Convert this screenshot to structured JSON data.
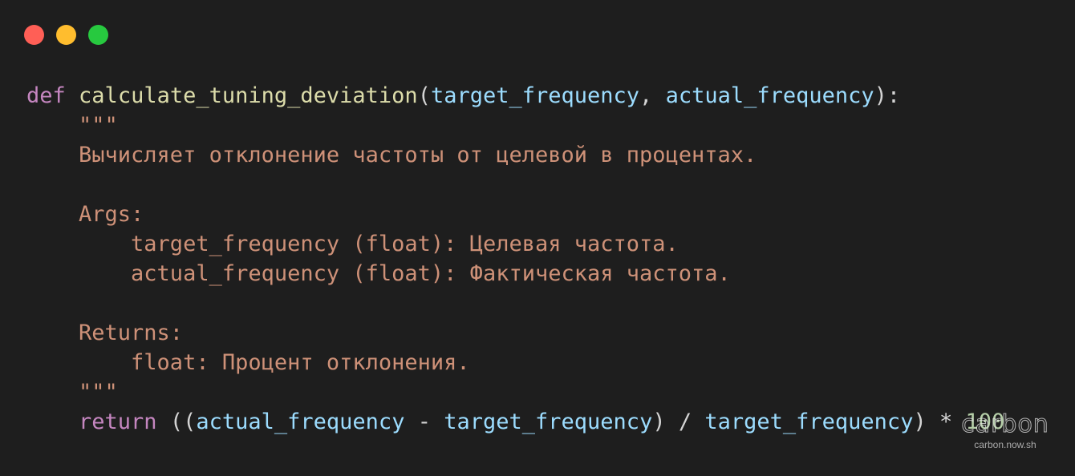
{
  "window": {
    "background": "#1e1e1e",
    "controls": [
      "close",
      "minimize",
      "zoom"
    ],
    "control_colors": {
      "close": "#ff5f56",
      "minimize": "#ffbd2e",
      "zoom": "#27c93f"
    }
  },
  "code": {
    "language": "python",
    "lines": [
      [
        [
          "kw",
          "def"
        ],
        [
          "punc",
          " "
        ],
        [
          "fn",
          "calculate_tuning_deviation"
        ],
        [
          "punc",
          "("
        ],
        [
          "param",
          "target_frequency"
        ],
        [
          "punc",
          ", "
        ],
        [
          "param",
          "actual_frequency"
        ],
        [
          "punc",
          "):"
        ]
      ],
      [
        [
          "str",
          "    \"\"\""
        ]
      ],
      [
        [
          "str",
          "    Вычисляет отклонение частоты от целевой в процентах."
        ]
      ],
      [
        [
          "punc",
          ""
        ]
      ],
      [
        [
          "str",
          "    Args:"
        ]
      ],
      [
        [
          "str",
          "        target_frequency (float): Целевая частота."
        ]
      ],
      [
        [
          "str",
          "        actual_frequency (float): Фактическая частота."
        ]
      ],
      [
        [
          "punc",
          ""
        ]
      ],
      [
        [
          "str",
          "    Returns:"
        ]
      ],
      [
        [
          "str",
          "        float: Процент отклонения."
        ]
      ],
      [
        [
          "str",
          "    \"\"\""
        ]
      ],
      [
        [
          "punc",
          "    "
        ],
        [
          "kw",
          "return"
        ],
        [
          "punc",
          " (("
        ],
        [
          "param",
          "actual_frequency"
        ],
        [
          "punc",
          " - "
        ],
        [
          "param",
          "target_frequency"
        ],
        [
          "punc",
          ") / "
        ],
        [
          "param",
          "target_frequency"
        ],
        [
          "punc",
          ") * "
        ],
        [
          "num",
          "100"
        ]
      ]
    ]
  },
  "watermark": {
    "logo": "carbon",
    "url": "carbon.now.sh"
  }
}
